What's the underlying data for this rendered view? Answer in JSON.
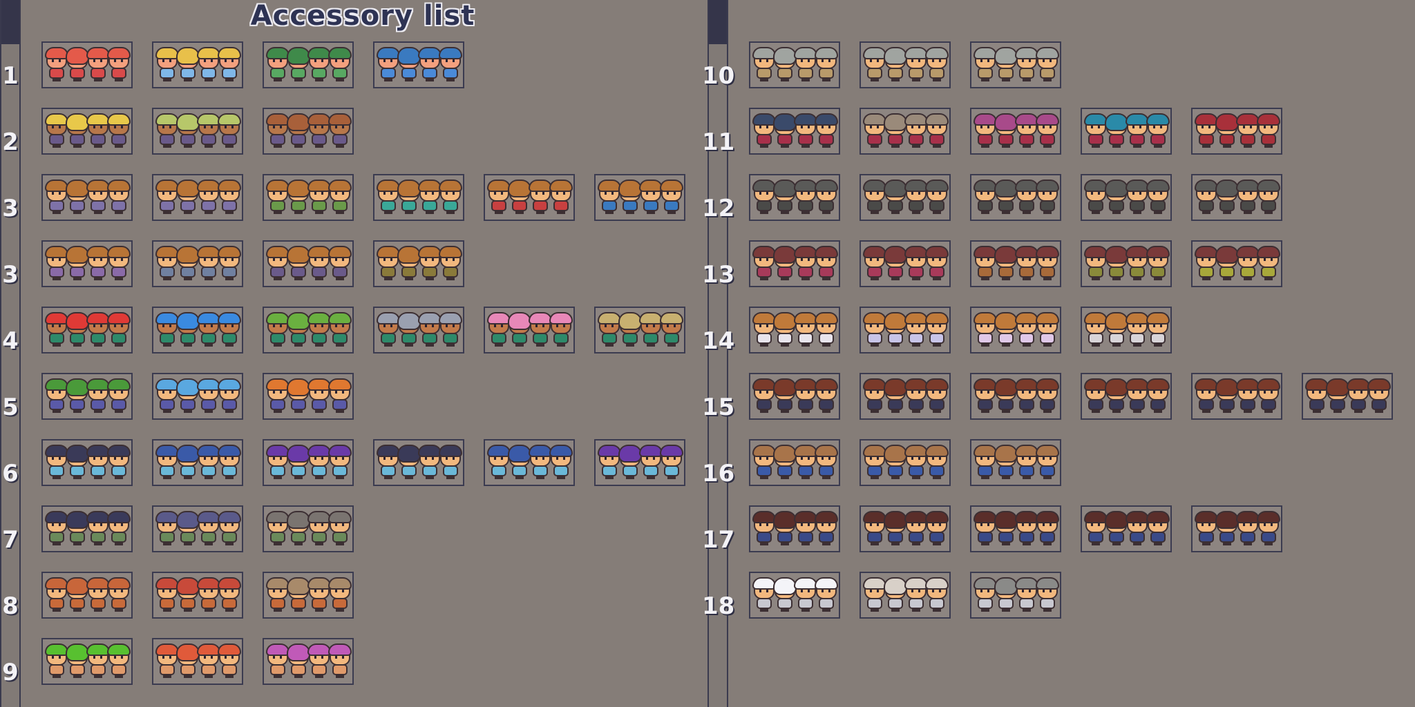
{
  "title": "Accessory list",
  "colors": {
    "background": "#857d78",
    "frame_border": "#3b3b50",
    "frame_fill": "#8d8581",
    "label_text": "#f3f2f6",
    "title_text": "#2e3354"
  },
  "rows": [
    {
      "label": "1",
      "sets": [
        {
          "hat": "#e45a4a",
          "body": "#d94a4a",
          "skin": "#f3a07e"
        },
        {
          "hat": "#e8c04a",
          "body": "#7fb7e8",
          "skin": "#f3a07e"
        },
        {
          "hat": "#3f8a4a",
          "body": "#58a862",
          "skin": "#f3a07e"
        },
        {
          "hat": "#3a7ac0",
          "body": "#4a8ad8",
          "skin": "#f3a07e"
        }
      ]
    },
    {
      "label": "2",
      "sets": [
        {
          "hat": "#e8c84a",
          "body": "#6a5a8a",
          "skin": "#b7774a"
        },
        {
          "hat": "#b7c76a",
          "body": "#6a5a8a",
          "skin": "#b7774a"
        },
        {
          "hat": "#a8603a",
          "body": "#6a5a8a",
          "skin": "#b7774a"
        }
      ]
    },
    {
      "label": "3",
      "sets": [
        {
          "hat": "#b87436",
          "body": "#7e72a8",
          "skin": "#f2b87e"
        },
        {
          "hat": "#b87436",
          "body": "#7e72a8",
          "skin": "#f2b87e"
        },
        {
          "hat": "#b87436",
          "body": "#6a9a4a",
          "skin": "#f2b87e"
        },
        {
          "hat": "#b87436",
          "body": "#3aa898",
          "skin": "#f2b87e"
        },
        {
          "hat": "#b87436",
          "body": "#c84040",
          "skin": "#f2b87e"
        },
        {
          "hat": "#b87436",
          "body": "#3a7ac0",
          "skin": "#f2b87e"
        }
      ]
    },
    {
      "label": "3",
      "sets": [
        {
          "hat": "#b87436",
          "body": "#8a6aa8",
          "skin": "#f2b87e"
        },
        {
          "hat": "#b87436",
          "body": "#7080a0",
          "skin": "#f2b87e"
        },
        {
          "hat": "#b87436",
          "body": "#6a5a8a",
          "skin": "#f2b87e"
        },
        {
          "hat": "#b87436",
          "body": "#8a7a3a",
          "skin": "#f2b87e"
        }
      ]
    },
    {
      "label": "4",
      "sets": [
        {
          "hat": "#e03a36",
          "body": "#2e8a6a",
          "skin": "#c27a4a"
        },
        {
          "hat": "#3a8ae0",
          "body": "#2e8a6a",
          "skin": "#c27a4a"
        },
        {
          "hat": "#6ab040",
          "body": "#2e8a6a",
          "skin": "#c27a4a"
        },
        {
          "hat": "#9aa0b0",
          "body": "#2e8a6a",
          "skin": "#c27a4a"
        },
        {
          "hat": "#e888b8",
          "body": "#2e8a6a",
          "skin": "#c27a4a"
        },
        {
          "hat": "#c8b070",
          "body": "#2e8a6a",
          "skin": "#c27a4a"
        }
      ]
    },
    {
      "label": "5",
      "sets": [
        {
          "hat": "#4a9a3a",
          "body": "#5a5aa8",
          "skin": "#f2b87e"
        },
        {
          "hat": "#5aa8e0",
          "body": "#5a5aa8",
          "skin": "#f2b87e"
        },
        {
          "hat": "#e07830",
          "body": "#5a5aa8",
          "skin": "#f2b87e"
        }
      ]
    },
    {
      "label": "6",
      "sets": [
        {
          "hat": "#3a3a58",
          "body": "#6ab8d8",
          "skin": "#f2b87e"
        },
        {
          "hat": "#3a5aa8",
          "body": "#6ab8d8",
          "skin": "#f2b87e"
        },
        {
          "hat": "#6a3aa8",
          "body": "#6ab8d8",
          "skin": "#f2b87e"
        },
        {
          "hat": "#3a3a58",
          "body": "#6ab8d8",
          "skin": "#f2b87e"
        },
        {
          "hat": "#3a5aa8",
          "body": "#6ab8d8",
          "skin": "#f2b87e"
        },
        {
          "hat": "#6a3aa8",
          "body": "#6ab8d8",
          "skin": "#f2b87e"
        }
      ]
    },
    {
      "label": "7",
      "sets": [
        {
          "hat": "#3a3a5a",
          "body": "#6a8a5a",
          "skin": "#f2b87e"
        },
        {
          "hat": "#5a5a8a",
          "body": "#6a8a5a",
          "skin": "#f2b87e"
        },
        {
          "hat": "#7a7470",
          "body": "#6a8a5a",
          "skin": "#f2b87e"
        }
      ]
    },
    {
      "label": "8",
      "sets": [
        {
          "hat": "#c8663a",
          "body": "#c86a3a",
          "skin": "#f2b87e"
        },
        {
          "hat": "#c84a3a",
          "body": "#c86a3a",
          "skin": "#f2b87e"
        },
        {
          "hat": "#a88a6a",
          "body": "#c86a3a",
          "skin": "#f2b87e"
        }
      ]
    },
    {
      "label": "9",
      "sets": [
        {
          "hat": "#58c030",
          "body": "#e09a6a",
          "skin": "#f2b87e"
        },
        {
          "hat": "#e05a3a",
          "body": "#e09a6a",
          "skin": "#f2b87e"
        },
        {
          "hat": "#c05ab8",
          "body": "#e09a6a",
          "skin": "#f2b87e"
        }
      ]
    },
    {
      "label": "10",
      "sets": [
        {
          "hat": "#a0a4a0",
          "body": "#b89a6a",
          "skin": "#f2b87e"
        },
        {
          "hat": "#a0a4a0",
          "body": "#b89a6a",
          "skin": "#f2b87e"
        },
        {
          "hat": "#a0a4a0",
          "body": "#b89a6a",
          "skin": "#f2b87e"
        }
      ]
    },
    {
      "label": "11",
      "sets": [
        {
          "hat": "#3a4a6a",
          "body": "#a8304a",
          "skin": "#f2b87e"
        },
        {
          "hat": "#9a8a7a",
          "body": "#a8304a",
          "skin": "#f2b87e"
        },
        {
          "hat": "#a84a8a",
          "body": "#a8304a",
          "skin": "#f2b87e"
        },
        {
          "hat": "#2a8aa8",
          "body": "#a8304a",
          "skin": "#f2b87e"
        },
        {
          "hat": "#a8303a",
          "body": "#a8303a",
          "skin": "#f2b87e"
        }
      ]
    },
    {
      "label": "12",
      "sets": [
        {
          "hat": "#5a5a58",
          "body": "#4a4a48",
          "skin": "#f2b87e"
        },
        {
          "hat": "#5a5a58",
          "body": "#4a4a48",
          "skin": "#f2b87e"
        },
        {
          "hat": "#5a5a58",
          "body": "#4a4a48",
          "skin": "#f2b87e"
        },
        {
          "hat": "#5a5a58",
          "body": "#4a4a48",
          "skin": "#f2b87e"
        },
        {
          "hat": "#5a5a58",
          "body": "#4a4a48",
          "skin": "#f2b87e"
        }
      ]
    },
    {
      "label": "13",
      "sets": [
        {
          "hat": "#7a3a3a",
          "body": "#a83a5a",
          "skin": "#f2b87e"
        },
        {
          "hat": "#7a3a3a",
          "body": "#a83a5a",
          "skin": "#f2b87e"
        },
        {
          "hat": "#7a3a3a",
          "body": "#a86a3a",
          "skin": "#f2b87e"
        },
        {
          "hat": "#7a3a3a",
          "body": "#8a8a3a",
          "skin": "#f2b87e"
        },
        {
          "hat": "#7a3a3a",
          "body": "#a8a83a",
          "skin": "#f2b87e"
        }
      ]
    },
    {
      "label": "14",
      "sets": [
        {
          "hat": "#c07a3a",
          "body": "#e8e4ec",
          "skin": "#f2b87e"
        },
        {
          "hat": "#c07a3a",
          "body": "#c8c4e8",
          "skin": "#f2b87e"
        },
        {
          "hat": "#c07a3a",
          "body": "#e0c8e8",
          "skin": "#f2b87e"
        },
        {
          "hat": "#c07a3a",
          "body": "#d8d4d8",
          "skin": "#f2b87e"
        }
      ]
    },
    {
      "label": "15",
      "sets": [
        {
          "hat": "#7a3a2a",
          "body": "#3a3a58",
          "skin": "#f2b87e"
        },
        {
          "hat": "#7a3a2a",
          "body": "#3a3a58",
          "skin": "#f2b87e"
        },
        {
          "hat": "#7a3a2a",
          "body": "#3a3a58",
          "skin": "#f2b87e"
        },
        {
          "hat": "#7a3a2a",
          "body": "#3a3a58",
          "skin": "#f2b87e"
        },
        {
          "hat": "#7a3a2a",
          "body": "#3a3a58",
          "skin": "#f2b87e"
        },
        {
          "hat": "#7a3a2a",
          "body": "#3a3a58",
          "skin": "#f2b87e"
        }
      ]
    },
    {
      "label": "16",
      "sets": [
        {
          "hat": "#a8744a",
          "body": "#3a5aa8",
          "skin": "#f2b87e"
        },
        {
          "hat": "#a8744a",
          "body": "#3a5aa8",
          "skin": "#f2b87e"
        },
        {
          "hat": "#a8744a",
          "body": "#3a5aa8",
          "skin": "#f2b87e"
        }
      ]
    },
    {
      "label": "17",
      "sets": [
        {
          "hat": "#5a2e2a",
          "body": "#3a4a88",
          "skin": "#f2b87e"
        },
        {
          "hat": "#5a2e2a",
          "body": "#3a4a88",
          "skin": "#f2b87e"
        },
        {
          "hat": "#5a2e2a",
          "body": "#3a4a88",
          "skin": "#f2b87e"
        },
        {
          "hat": "#5a2e2a",
          "body": "#3a4a88",
          "skin": "#f2b87e"
        },
        {
          "hat": "#5a2e2a",
          "body": "#3a4a88",
          "skin": "#f2b87e"
        }
      ]
    },
    {
      "label": "18",
      "sets": [
        {
          "hat": "#f4f4f8",
          "body": "#c8c8d0",
          "skin": "#f2b87e"
        },
        {
          "hat": "#d8d0c8",
          "body": "#c8c8d0",
          "skin": "#f2b87e"
        },
        {
          "hat": "#8a8a88",
          "body": "#c8c8d0",
          "skin": "#f2b87e"
        }
      ]
    }
  ]
}
